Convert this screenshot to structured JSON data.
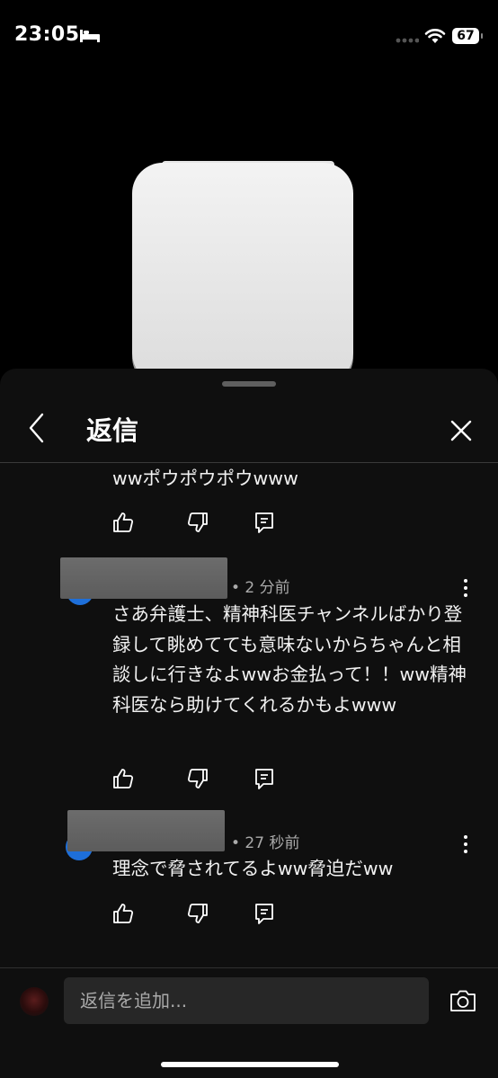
{
  "status_bar": {
    "time": "23:05",
    "battery": "67"
  },
  "sheet": {
    "title": "返信"
  },
  "comments": [
    {
      "text": "wwポウポウポウwww"
    },
    {
      "meta": "• 2 分前",
      "text": "さあ弁護士、精神科医チャンネルばかり登録して眺めてても意味ないからちゃんと相談しに行きなよwwお金払って！！ww精神科医なら助けてくれるかもよwww"
    },
    {
      "meta": "• 27 秒前",
      "text": "理念で脅されてるよww脅迫だww"
    }
  ],
  "composer": {
    "placeholder": "返信を追加..."
  },
  "icons": {
    "bed": "bed-icon",
    "wifi": "wifi-icon",
    "like": "thumbs-up-icon",
    "dislike": "thumbs-down-icon",
    "reply": "reply-icon",
    "more": "more-vert-icon",
    "back": "chevron-left-icon",
    "close": "close-icon",
    "camera": "camera-icon"
  },
  "colors": {
    "background": "#0f0f0f",
    "avatar_accent": "#1e6fd9",
    "meta_text": "#aaaaaa"
  }
}
